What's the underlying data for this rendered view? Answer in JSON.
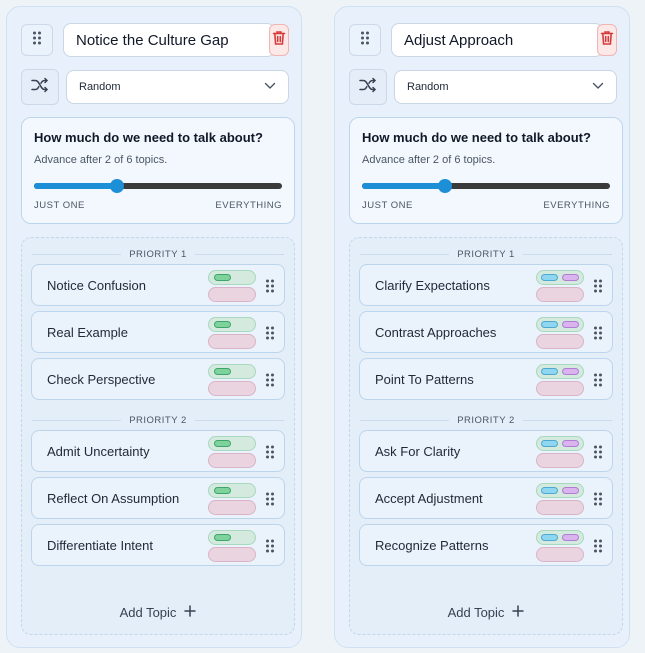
{
  "columns": [
    {
      "title": "Notice the Culture Gap",
      "order_mode": "Random",
      "talk": {
        "heading": "How much do we need to talk about?",
        "advance_text": "Advance after 2 of 6 topics.",
        "slider_value": 2,
        "slider_max": 6,
        "min_label": "JUST ONE",
        "max_label": "EVERYTHING"
      },
      "priorities": [
        {
          "label": "PRIORITY 1",
          "topics": [
            {
              "label": "Notice Confusion",
              "tag_style": "green"
            },
            {
              "label": "Real Example",
              "tag_style": "green"
            },
            {
              "label": "Check Perspective",
              "tag_style": "green"
            }
          ]
        },
        {
          "label": "PRIORITY 2",
          "topics": [
            {
              "label": "Admit Uncertainty",
              "tag_style": "green"
            },
            {
              "label": "Reflect On Assumption",
              "tag_style": "green"
            },
            {
              "label": "Differentiate Intent",
              "tag_style": "green"
            }
          ]
        }
      ],
      "add_label": "Add Topic"
    },
    {
      "title": "Adjust Approach",
      "order_mode": "Random",
      "talk": {
        "heading": "How much do we need to talk about?",
        "advance_text": "Advance after 2 of 6 topics.",
        "slider_value": 2,
        "slider_max": 6,
        "min_label": "JUST ONE",
        "max_label": "EVERYTHING"
      },
      "priorities": [
        {
          "label": "PRIORITY 1",
          "topics": [
            {
              "label": "Clarify Expectations",
              "tag_style": "blue-purple"
            },
            {
              "label": "Contrast Approaches",
              "tag_style": "blue-purple"
            },
            {
              "label": "Point To Patterns",
              "tag_style": "blue-purple"
            }
          ]
        },
        {
          "label": "PRIORITY 2",
          "topics": [
            {
              "label": "Ask For Clarity",
              "tag_style": "blue-purple"
            },
            {
              "label": "Accept Adjustment",
              "tag_style": "blue-purple"
            },
            {
              "label": "Recognize Patterns",
              "tag_style": "blue-purple"
            }
          ]
        }
      ],
      "add_label": "Add Topic"
    }
  ],
  "icons": {
    "handle": "grip-vertical-icon",
    "delete": "trash-icon",
    "shuffle": "shuffle-icon",
    "dropdown": "chevron-down-icon",
    "add": "plus-icon"
  },
  "colors": {
    "accent": "#1c8fd6",
    "delete": "#d63b3b",
    "tag_green": "#7ed39c",
    "tag_blue": "#8fd6f0",
    "tag_purple": "#dab4ee",
    "tag_pink": "#ead4e0"
  }
}
